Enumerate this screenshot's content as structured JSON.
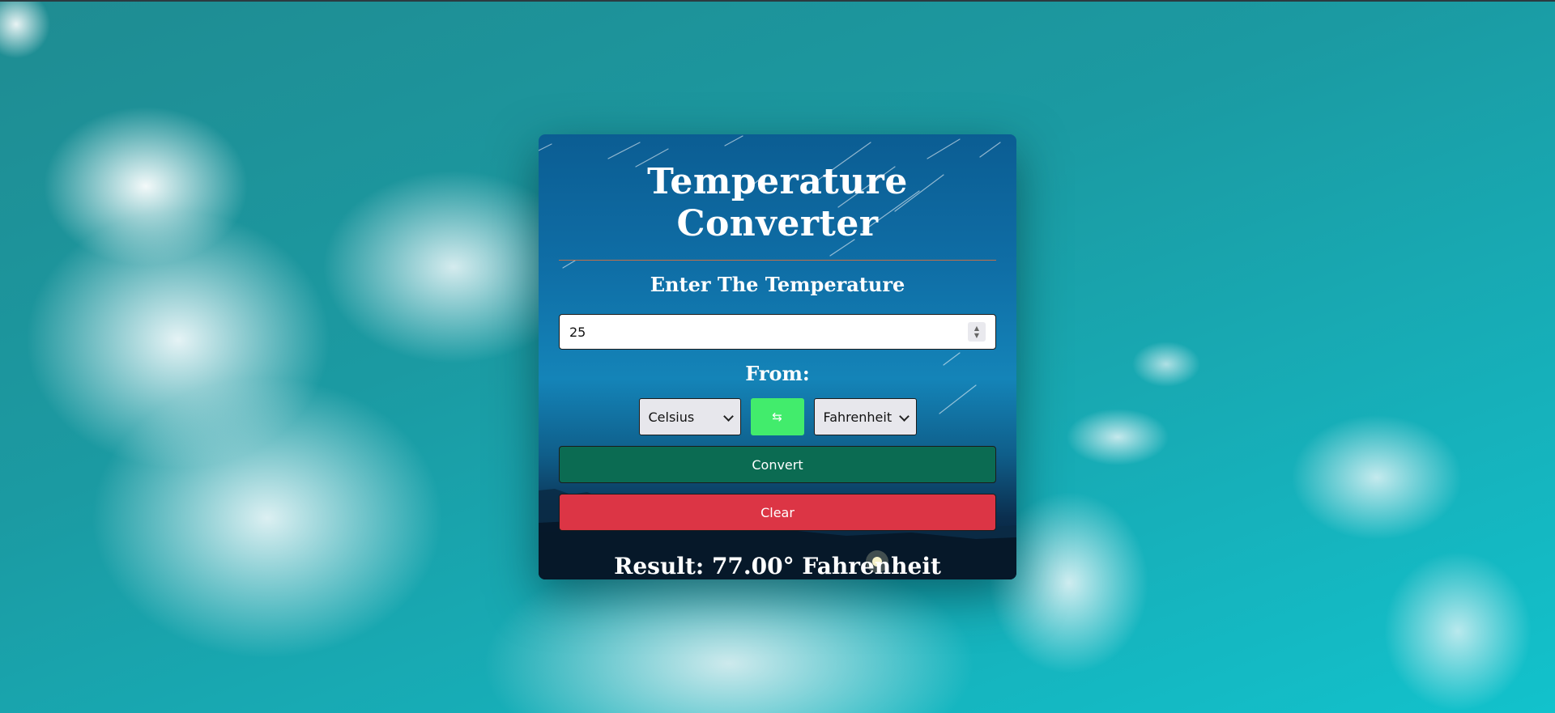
{
  "app": {
    "title": "Temperature Converter",
    "subtitle": "Enter The Temperature"
  },
  "input": {
    "value": "25"
  },
  "conversion": {
    "from_label": "From:",
    "from_unit": "Celsius",
    "to_unit": "Fahrenheit",
    "swap_icon": "⇆"
  },
  "buttons": {
    "convert_label": "Convert",
    "clear_label": "Clear"
  },
  "result": {
    "text": "Result: 77.00° Fahrenheit"
  },
  "colors": {
    "convert": "#0b6b52",
    "clear": "#dc3545",
    "swap": "#42ec6c",
    "divider": "#c0704b"
  }
}
